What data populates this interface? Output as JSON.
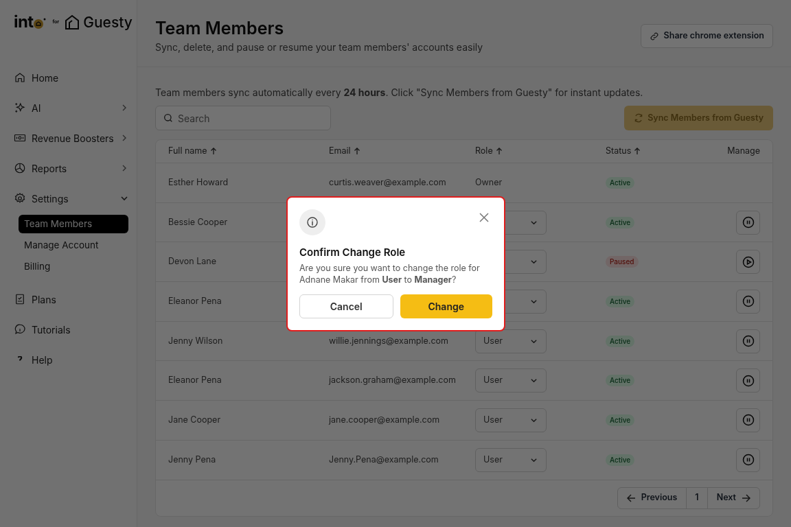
{
  "logo": {
    "brand": "int",
    "for": "for",
    "partner": "Guesty"
  },
  "sidebar": {
    "items": [
      {
        "label": "Home"
      },
      {
        "label": "AI",
        "expanded": false
      },
      {
        "label": "Revenue Boosters",
        "expanded": false
      },
      {
        "label": "Reports",
        "expanded": false
      },
      {
        "label": "Settings",
        "expanded": true,
        "children": [
          {
            "label": "Team Members",
            "selected": true
          },
          {
            "label": "Manage Account",
            "selected": false
          },
          {
            "label": "Billing",
            "selected": false
          }
        ]
      },
      {
        "label": "Plans"
      },
      {
        "label": "Tutorials"
      },
      {
        "label": "Help"
      }
    ]
  },
  "header": {
    "title": "Team Members",
    "subtitle": "Sync, delete, and pause or resume your team members' accounts easily",
    "share_button": "Share chrome extension"
  },
  "notice": "Team members sync automatically every **24 hours**. Click \"Sync Members from Guesty\" for instant updates.",
  "search": {
    "placeholder": "Search"
  },
  "sync_button": {
    "label": "Sync Members from Guesty",
    "disabled": true
  },
  "table": {
    "columns": [
      {
        "label": "Full name",
        "sortable": true
      },
      {
        "label": "Email",
        "sortable": true
      },
      {
        "label": "Role",
        "sortable": true
      },
      {
        "label": "Status",
        "sortable": true
      },
      {
        "label": "Manage",
        "sortable": false
      }
    ],
    "rows": [
      {
        "kind": "owner",
        "name": "Esther Howard",
        "email": "curtis.weaver@example.com",
        "role": "Owner",
        "status": "Active",
        "paused": false
      },
      {
        "kind": "member",
        "name": "Bessie Cooper",
        "status": "Active",
        "paused": false
      },
      {
        "kind": "member",
        "name": "Devon Lane",
        "status": "Paused",
        "paused": true
      },
      {
        "kind": "member",
        "name": "Eleanor Pena",
        "status": "Active",
        "paused": false
      },
      {
        "kind": "member",
        "name": "Jenny Wilson",
        "email": "willie.jennings@example.com",
        "role": "User",
        "status": "Active",
        "paused": false
      },
      {
        "kind": "member",
        "name": "Eleanor Pena",
        "email": "jackson.graham@example.com",
        "role": "User",
        "status": "Active",
        "paused": false
      },
      {
        "kind": "member",
        "name": "Jane Cooper",
        "email": "jane.cooper@example.com",
        "role": "User",
        "status": "Active",
        "paused": false
      },
      {
        "kind": "member",
        "name": "Jenny Pena",
        "email": "Jenny.Pena@example.com",
        "role": "User",
        "status": "Active",
        "paused": false
      }
    ]
  },
  "pagination": {
    "previous": "Previous",
    "page": "1",
    "next": "Next"
  },
  "dialog": {
    "title": "Confirm Change Role",
    "message": "Are you sure you want to change the role for Adnane Makar from **User** to **Manager**?",
    "cancel": "Cancel",
    "confirm": "Change"
  }
}
